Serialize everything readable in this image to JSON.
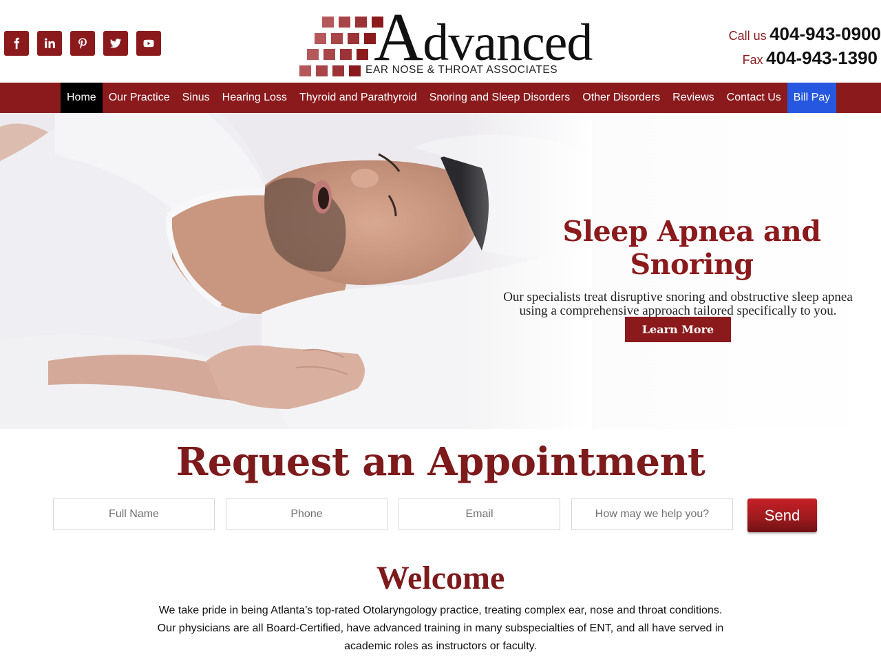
{
  "social": [
    {
      "name": "facebook",
      "icon": "facebook-icon"
    },
    {
      "name": "linkedin",
      "icon": "linkedin-icon"
    },
    {
      "name": "pinterest",
      "icon": "pinterest-icon"
    },
    {
      "name": "twitter",
      "icon": "twitter-icon"
    },
    {
      "name": "youtube",
      "icon": "youtube-icon"
    }
  ],
  "logo": {
    "word_initial": "A",
    "word_rest": "dvanced",
    "subtitle": "EAR NOSE & THROAT ASSOCIATES"
  },
  "contact": {
    "call_label": "Call us",
    "call_number": "404-943-0900",
    "fax_label": "Fax",
    "fax_number": "404-943-1390"
  },
  "nav": {
    "items": [
      {
        "label": "Home",
        "active": true
      },
      {
        "label": "Our Practice"
      },
      {
        "label": "Sinus"
      },
      {
        "label": "Hearing Loss"
      },
      {
        "label": "Thyroid and Parathyroid"
      },
      {
        "label": "Snoring and Sleep Disorders"
      },
      {
        "label": "Other Disorders"
      },
      {
        "label": "Reviews"
      },
      {
        "label": "Contact Us"
      },
      {
        "label": "Bill Pay",
        "highlight": true
      }
    ]
  },
  "hero": {
    "title": "Sleep Apnea and Snoring",
    "subtitle_line1": "Our specialists treat disruptive snoring and obstructive sleep apnea",
    "subtitle_line2": "using a comprehensive approach tailored specifically to you.",
    "cta_label": "Learn More"
  },
  "appointment": {
    "title": "Request an Appointment",
    "fields": {
      "name_placeholder": "Full Name",
      "phone_placeholder": "Phone",
      "email_placeholder": "Email",
      "message_placeholder": "How may we help you?"
    },
    "send_label": "Send"
  },
  "welcome": {
    "title": "Welcome",
    "line1": "We take pride in being Atlanta’s top-rated Otolaryngology practice, treating complex ear, nose and throat conditions.",
    "line2": "Our physicians are all Board-Certified, have advanced training in many subspecialties of ENT, and all have served in",
    "line3": "academic roles as instructors or faculty."
  },
  "colors": {
    "brand_red": "#8b1a1d",
    "heading_red": "#7d1a1c",
    "nav_active": "#000000",
    "bill_pay_blue": "#2657e0"
  }
}
